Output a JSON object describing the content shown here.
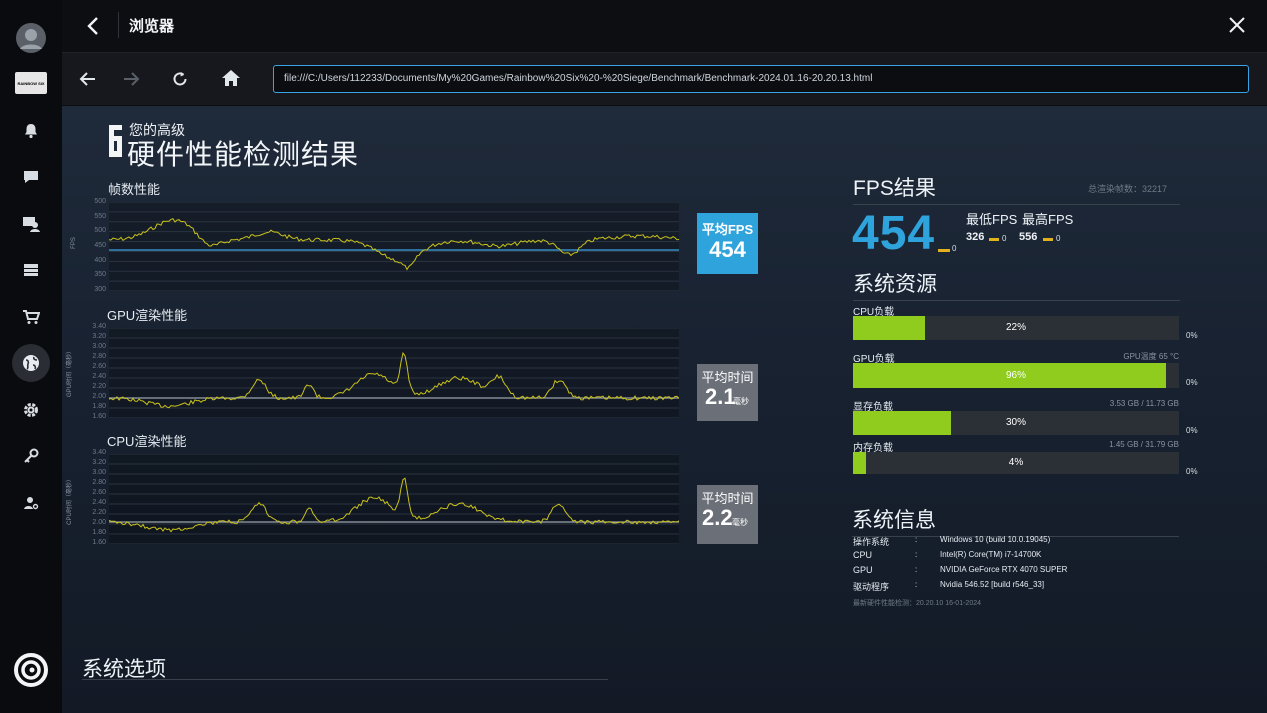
{
  "window": {
    "title": "浏览器"
  },
  "nav": {
    "url": "file:///C:/Users/112233/Documents/My%20Games/Rainbow%20Six%20-%20Siege/Benchmark/Benchmark-2024.01.16-20.20.13.html"
  },
  "sidebar": {
    "logo_text": "RAINBOW SIX"
  },
  "report": {
    "header_small": "您的高级",
    "header_big": "硬件性能检测结果",
    "fps_chart": {
      "title": "帧数性能",
      "ylabel": "FPS",
      "yticks": [
        "500",
        "550",
        "500",
        "450",
        "400",
        "350",
        "300"
      ],
      "badge_label": "平均FPS",
      "badge_value": "454"
    },
    "gpu_chart": {
      "title": "GPU渲染性能",
      "ylabel": "GPU时间（毫秒）",
      "yticks": [
        "3.40",
        "3.20",
        "3.00",
        "2.80",
        "2.60",
        "2.40",
        "2.20",
        "2.00",
        "1.80",
        "1.60"
      ],
      "badge_label": "平均时间",
      "badge_value": "2.1",
      "badge_unit": "毫秒"
    },
    "cpu_chart": {
      "title": "CPU渲染性能",
      "ylabel": "CPU时间（毫秒）",
      "yticks": [
        "3.40",
        "3.20",
        "3.00",
        "2.80",
        "2.60",
        "2.40",
        "2.20",
        "2.00",
        "1.80",
        "1.60"
      ],
      "badge_label": "平均时间",
      "badge_value": "2.2",
      "badge_unit": "毫秒"
    },
    "fps_result": {
      "title": "FPS结果",
      "total_frames": "总渲染帧数：32217",
      "avg": "454",
      "avg_suffix": "0",
      "min_label": "最低FPS",
      "max_label": "最高FPS",
      "min_value": "326",
      "min_suffix": "0",
      "max_value": "556",
      "max_suffix": "0"
    },
    "resources": {
      "title": "系统资源",
      "items": [
        {
          "label": "CPU负载",
          "pct": "22%",
          "fill": 0.22,
          "extra": "",
          "right": "0%"
        },
        {
          "label": "GPU负载",
          "pct": "96%",
          "fill": 0.96,
          "extra": "GPU温度 65 °C",
          "right": "0%"
        },
        {
          "label": "显存负载",
          "pct": "30%",
          "fill": 0.3,
          "extra": "3.53 GB / 11.73 GB",
          "right": "0%"
        },
        {
          "label": "内存负载",
          "pct": "4%",
          "fill": 0.04,
          "extra": "1.45 GB / 31.79 GB",
          "right": "0%"
        }
      ]
    },
    "sysinfo": {
      "title": "系统信息",
      "rows": [
        {
          "k": "操作系统",
          "v": "Windows 10 (build 10.0.19045)"
        },
        {
          "k": "CPU",
          "v": "Intel(R) Core(TM) i7-14700K"
        },
        {
          "k": "GPU",
          "v": "NVIDIA GeForce RTX 4070 SUPER"
        },
        {
          "k": "驱动程序",
          "v": "Nvidia 546.52 [build r546_33]"
        }
      ],
      "footer": "最新硬件性能检测：20.20.10 16-01-2024"
    },
    "options_title": "系统选项"
  },
  "colors": {
    "accent": "#3aa3e3",
    "bar": "#8fcc1e",
    "line": "#c9c21a",
    "avg_line": "#3aa3e3",
    "gray_badge": "#6b7078"
  }
}
